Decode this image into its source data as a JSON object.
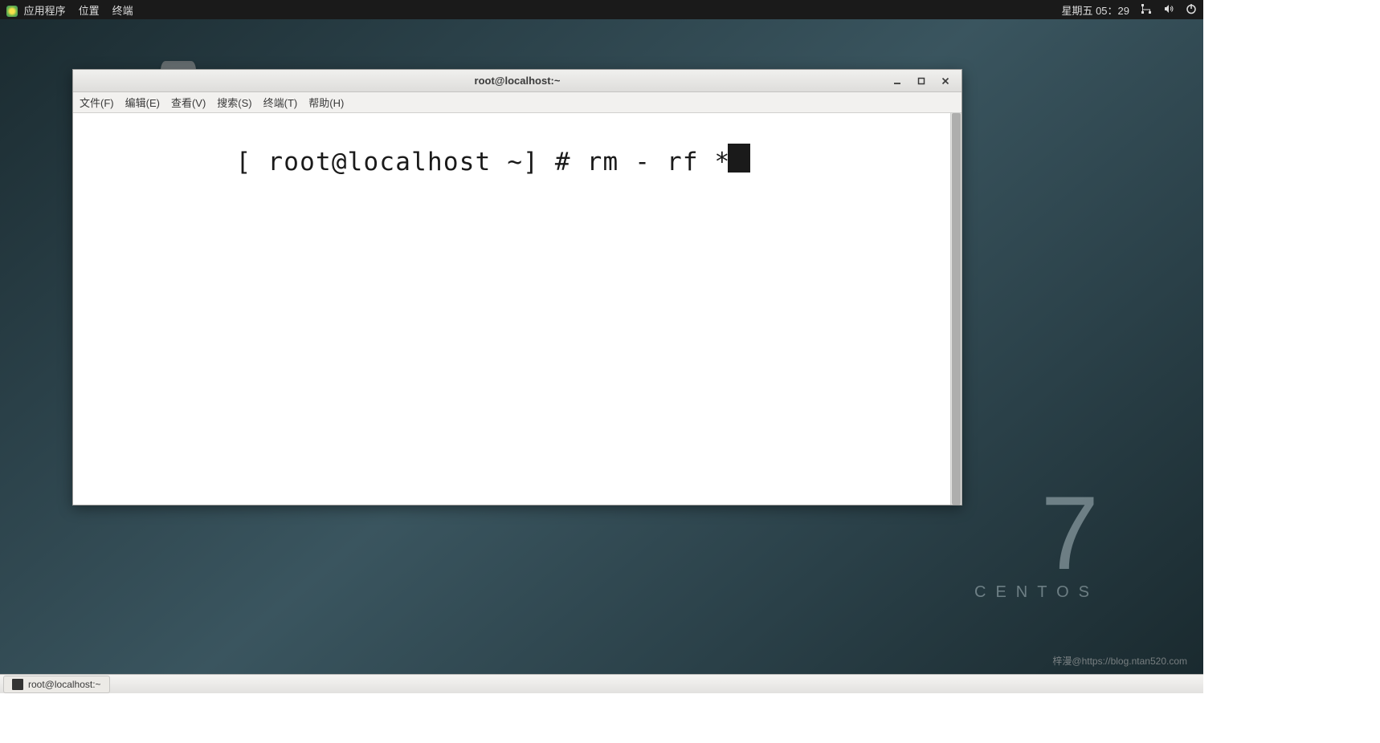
{
  "top_panel": {
    "apps": "应用程序",
    "places": "位置",
    "terminal": "终端",
    "datetime": "星期五 05：29"
  },
  "terminal": {
    "title": "root@localhost:~",
    "menus": {
      "file": "文件(F)",
      "edit": "编辑(E)",
      "view": "查看(V)",
      "search": "搜索(S)",
      "terminal": "终端(T)",
      "help": "帮助(H)"
    },
    "prompt": "[ root@localhost ~] # ",
    "command": "rm - rf *"
  },
  "desktop": {
    "centos_version": "7",
    "centos_label": "CENTOS",
    "watermark": "梓漫@https://blog.ntan520.com"
  },
  "taskbar": {
    "item_label": "root@localhost:~"
  }
}
